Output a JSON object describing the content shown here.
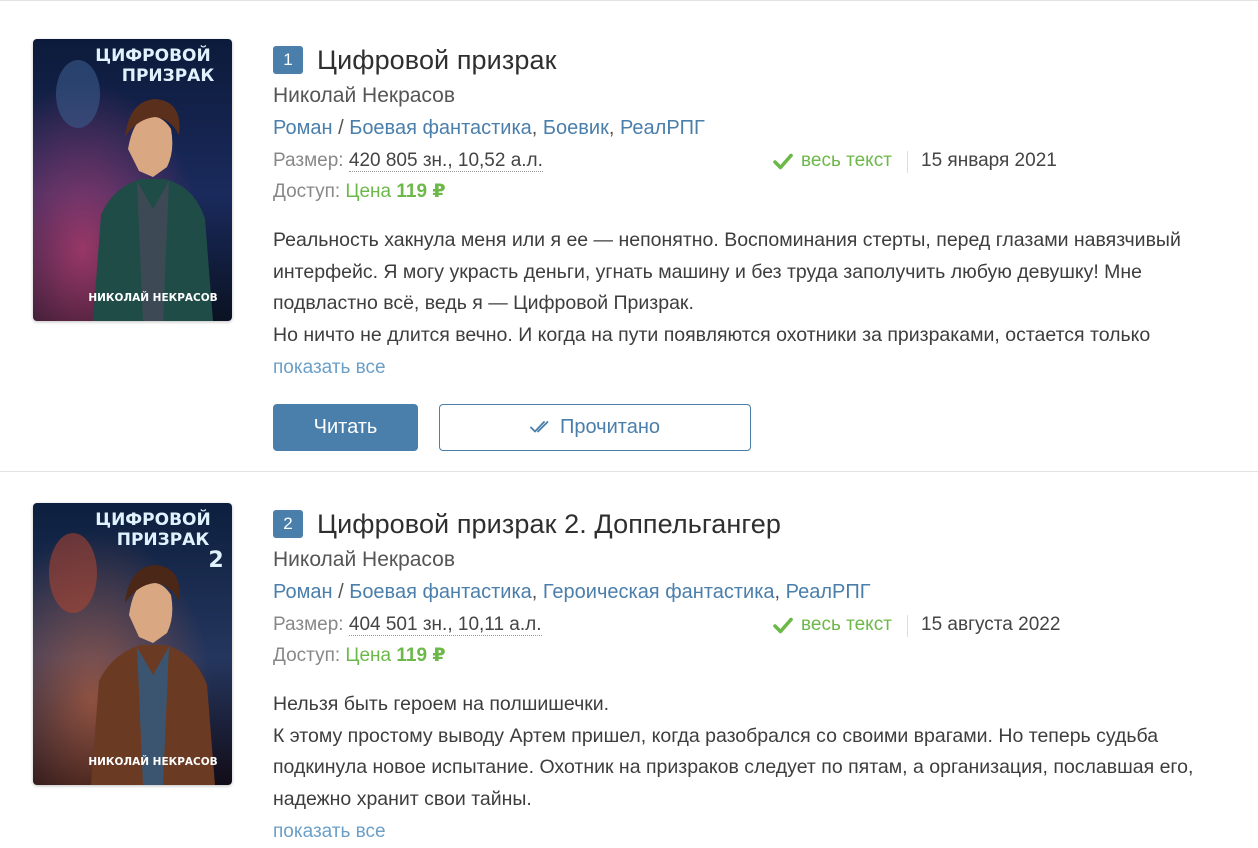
{
  "colors": {
    "accent": "#4a7eab",
    "link": "#6a9fc8",
    "green": "#6cb849",
    "text": "#333333",
    "muted": "#888888"
  },
  "books": [
    {
      "number": "1",
      "title": "Цифровой призрак",
      "author": "Николай Некрасов",
      "genres": {
        "form": "Роман",
        "separator": " / ",
        "items": [
          "Боевая фантастика",
          "Боевик",
          "РеалРПГ"
        ]
      },
      "cover": {
        "title_line1": "ЦИФРОВОЙ",
        "title_line2": "ПРИЗРАК",
        "volume": "",
        "author": "НИКОЛАЙ НЕКРАСОВ",
        "jacket_color": "#1f4c47"
      },
      "size_label": "Размер:",
      "size_value": "420 805 зн., 10,52 а.л.",
      "status_icon": "check-icon",
      "status": "весь текст",
      "date": "15 января 2021",
      "access_label": "Доступ:",
      "price_label": "Цена",
      "price_value": "119 ₽",
      "annotation": [
        "Реальность хакнула меня или я ее — непонятно. Воспоминания стерты, перед глазами навязчивый интерфейс. Я могу украсть деньги, угнать машину и без труда заполучить любую девушку! Мне подвластно всё, ведь я — Цифровой Призрак.",
        "Но ничто не длится вечно. И когда на пути появляются охотники за призраками, остается только"
      ],
      "show_all": "показать все",
      "read_button": "Читать",
      "done_button": "Прочитано"
    },
    {
      "number": "2",
      "title": "Цифровой призрак 2. Доппельгангер",
      "author": "Николай Некрасов",
      "genres": {
        "form": "Роман",
        "separator": " / ",
        "items": [
          "Боевая фантастика",
          "Героическая фантастика",
          "РеалРПГ"
        ]
      },
      "cover": {
        "title_line1": "ЦИФРОВОЙ",
        "title_line2": "ПРИЗРАК",
        "volume": "2",
        "author": "НИКОЛАЙ НЕКРАСОВ",
        "jacket_color": "#6b3a22"
      },
      "size_label": "Размер:",
      "size_value": "404 501 зн., 10,11 а.л.",
      "status_icon": "check-icon",
      "status": "весь текст",
      "date": "15 августа 2022",
      "access_label": "Доступ:",
      "price_label": "Цена",
      "price_value": "119 ₽",
      "annotation": [
        "Нельзя быть героем на полшишечки.",
        "К этому простому выводу Артем пришел, когда разобрался со своими врагами. Но теперь судьба подкинула новое испытание. Охотник на призраков следует по пятам, а организация, пославшая его, надежно хранит свои тайны."
      ],
      "show_all": "показать все"
    }
  ]
}
